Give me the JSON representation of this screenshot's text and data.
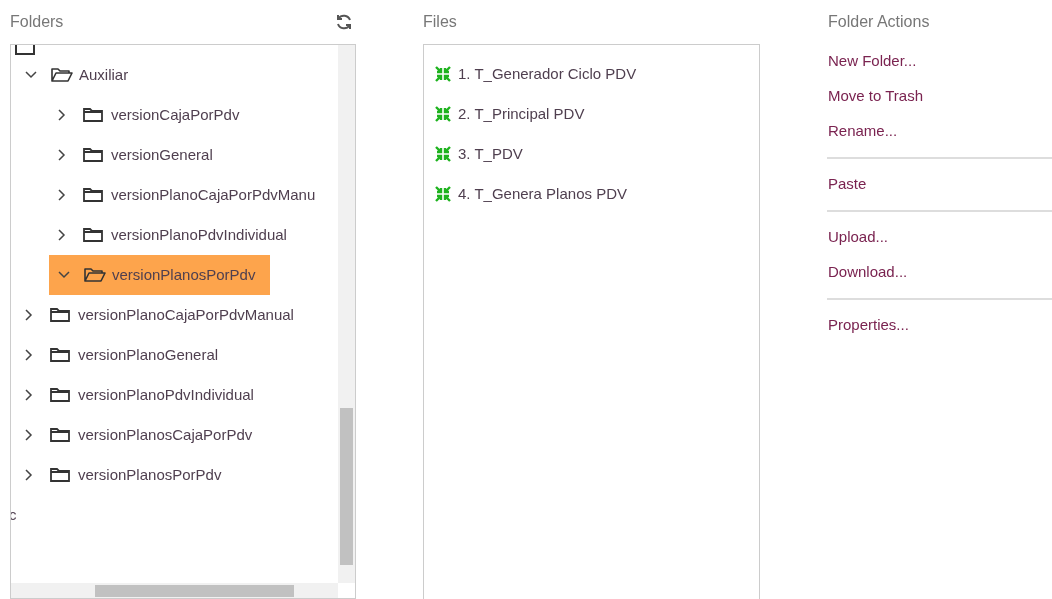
{
  "folders": {
    "title": "Folders",
    "tree": [
      {
        "label": "Auxiliar",
        "expanded": true,
        "selected": false,
        "children": [
          {
            "label": "versionCajaPorPdv",
            "expanded": false,
            "selected": false
          },
          {
            "label": "versionGeneral",
            "expanded": false,
            "selected": false
          },
          {
            "label": "versionPlanoCajaPorPdvManu",
            "expanded": false,
            "selected": false
          },
          {
            "label": "versionPlanoPdvIndividual",
            "expanded": false,
            "selected": false
          },
          {
            "label": "versionPlanosPorPdv",
            "expanded": true,
            "selected": true
          }
        ]
      },
      {
        "label": "versionPlanoCajaPorPdvManual",
        "expanded": false,
        "selected": false
      },
      {
        "label": "versionPlanoGeneral",
        "expanded": false,
        "selected": false
      },
      {
        "label": "versionPlanoPdvIndividual",
        "expanded": false,
        "selected": false
      },
      {
        "label": "versionPlanosCajaPorPdv",
        "expanded": false,
        "selected": false
      },
      {
        "label": "versionPlanosPorPdv",
        "expanded": false,
        "selected": false
      }
    ],
    "trailing": [
      "c"
    ]
  },
  "files": {
    "title": "Files",
    "items": [
      "1. T_Generador Ciclo PDV",
      "2. T_Principal PDV",
      "3. T_PDV",
      "4. T_Genera Planos PDV"
    ]
  },
  "folder_actions": {
    "title": "Folder Actions",
    "groups": [
      [
        "New Folder...",
        "Move to Trash",
        "Rename..."
      ],
      [
        "Paste"
      ],
      [
        "Upload...",
        "Download..."
      ],
      [
        "Properties..."
      ]
    ]
  }
}
